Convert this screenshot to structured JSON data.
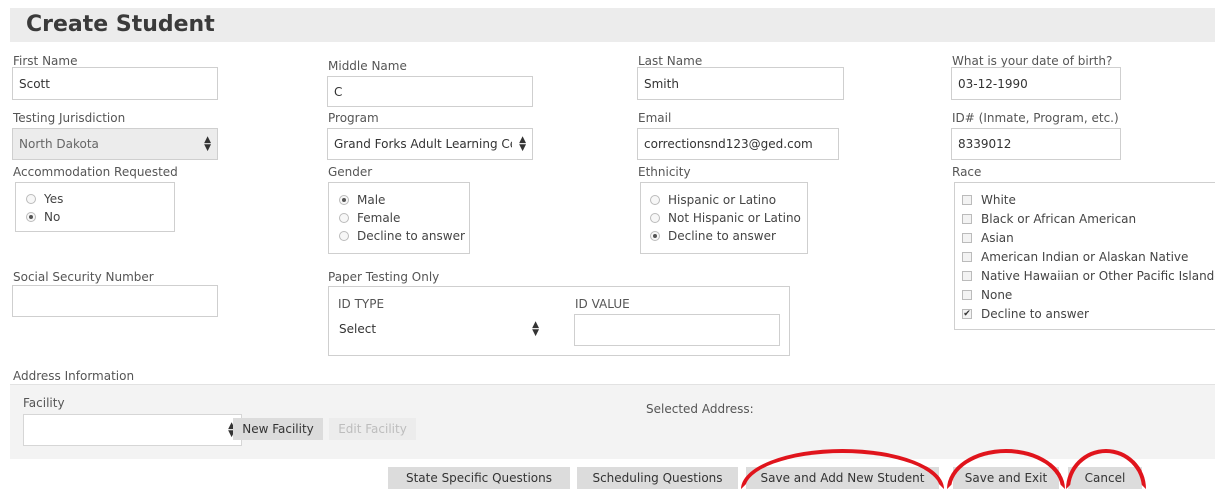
{
  "page": {
    "title": "Create Student"
  },
  "fields": {
    "first_name": {
      "label": "First Name",
      "value": "Scott"
    },
    "middle_name": {
      "label": "Middle Name",
      "value": "C"
    },
    "last_name": {
      "label": "Last Name",
      "value": "Smith"
    },
    "dob": {
      "label": "What is your date of birth?",
      "value": "03-12-1990"
    },
    "jurisdiction": {
      "label": "Testing Jurisdiction",
      "value": "North Dakota"
    },
    "program": {
      "label": "Program",
      "value": "Grand Forks Adult Learning Ce"
    },
    "email": {
      "label": "Email",
      "value": "correctionsnd123@ged.com"
    },
    "id_num": {
      "label": "ID# (Inmate, Program, etc.)",
      "value": "8339012"
    },
    "ssn": {
      "label": "Social Security Number",
      "value": ""
    }
  },
  "accommodation": {
    "label": "Accommodation Requested",
    "options": [
      "Yes",
      "No"
    ],
    "selected": "No"
  },
  "gender": {
    "label": "Gender",
    "options": [
      "Male",
      "Female",
      "Decline to answer"
    ],
    "selected": "Male"
  },
  "ethnicity": {
    "label": "Ethnicity",
    "options": [
      "Hispanic or Latino",
      "Not Hispanic or Latino",
      "Decline to answer"
    ],
    "selected": "Decline to answer"
  },
  "race": {
    "label": "Race",
    "options": [
      "White",
      "Black or African American",
      "Asian",
      "American Indian or Alaskan Native",
      "Native Hawaiian or Other Pacific Islander",
      "None",
      "Decline to answer"
    ],
    "checked": [
      "Decline to answer"
    ]
  },
  "paper_testing": {
    "label": "Paper Testing Only",
    "id_type_label": "ID TYPE",
    "id_type_value": "Select",
    "id_value_label": "ID VALUE",
    "id_value": ""
  },
  "address": {
    "section_label": "Address Information",
    "facility_label": "Facility",
    "facility_value": "",
    "new_facility": "New Facility",
    "edit_facility": "Edit Facility",
    "selected_address_label": "Selected Address:"
  },
  "footer": {
    "state_questions": "State Specific Questions",
    "scheduling_questions": "Scheduling Questions",
    "save_add_new": "Save and Add New Student",
    "save_exit": "Save and Exit",
    "cancel": "Cancel"
  },
  "colors": {
    "highlight": "#e0141c",
    "header_bg": "#ececec",
    "button_bg": "#dcdcdc"
  }
}
